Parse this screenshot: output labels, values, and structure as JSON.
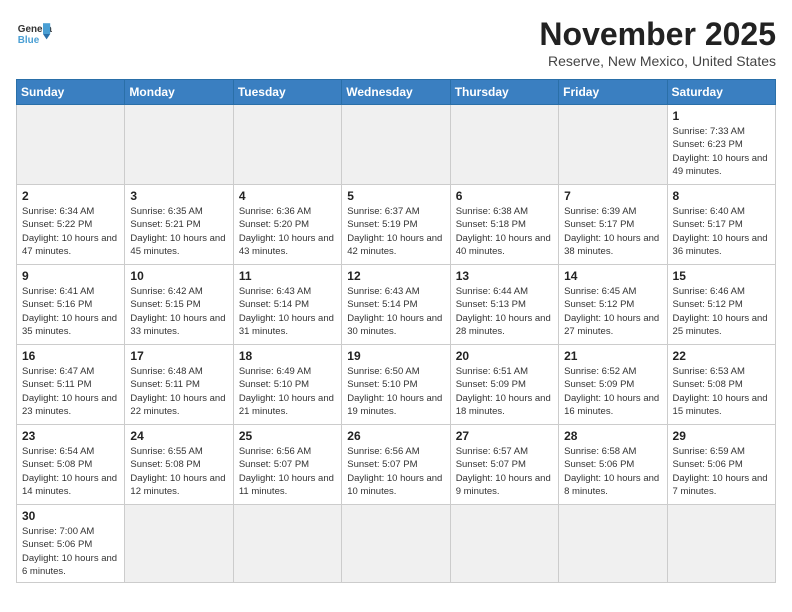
{
  "header": {
    "logo_line1": "General",
    "logo_line2": "Blue",
    "month_title": "November 2025",
    "location": "Reserve, New Mexico, United States"
  },
  "weekdays": [
    "Sunday",
    "Monday",
    "Tuesday",
    "Wednesday",
    "Thursday",
    "Friday",
    "Saturday"
  ],
  "weeks": [
    [
      {
        "day": "",
        "info": ""
      },
      {
        "day": "",
        "info": ""
      },
      {
        "day": "",
        "info": ""
      },
      {
        "day": "",
        "info": ""
      },
      {
        "day": "",
        "info": ""
      },
      {
        "day": "",
        "info": ""
      },
      {
        "day": "1",
        "info": "Sunrise: 7:33 AM\nSunset: 6:23 PM\nDaylight: 10 hours\nand 49 minutes."
      }
    ],
    [
      {
        "day": "2",
        "info": "Sunrise: 6:34 AM\nSunset: 5:22 PM\nDaylight: 10 hours\nand 47 minutes."
      },
      {
        "day": "3",
        "info": "Sunrise: 6:35 AM\nSunset: 5:21 PM\nDaylight: 10 hours\nand 45 minutes."
      },
      {
        "day": "4",
        "info": "Sunrise: 6:36 AM\nSunset: 5:20 PM\nDaylight: 10 hours\nand 43 minutes."
      },
      {
        "day": "5",
        "info": "Sunrise: 6:37 AM\nSunset: 5:19 PM\nDaylight: 10 hours\nand 42 minutes."
      },
      {
        "day": "6",
        "info": "Sunrise: 6:38 AM\nSunset: 5:18 PM\nDaylight: 10 hours\nand 40 minutes."
      },
      {
        "day": "7",
        "info": "Sunrise: 6:39 AM\nSunset: 5:17 PM\nDaylight: 10 hours\nand 38 minutes."
      },
      {
        "day": "8",
        "info": "Sunrise: 6:40 AM\nSunset: 5:17 PM\nDaylight: 10 hours\nand 36 minutes."
      }
    ],
    [
      {
        "day": "9",
        "info": "Sunrise: 6:41 AM\nSunset: 5:16 PM\nDaylight: 10 hours\nand 35 minutes."
      },
      {
        "day": "10",
        "info": "Sunrise: 6:42 AM\nSunset: 5:15 PM\nDaylight: 10 hours\nand 33 minutes."
      },
      {
        "day": "11",
        "info": "Sunrise: 6:43 AM\nSunset: 5:14 PM\nDaylight: 10 hours\nand 31 minutes."
      },
      {
        "day": "12",
        "info": "Sunrise: 6:43 AM\nSunset: 5:14 PM\nDaylight: 10 hours\nand 30 minutes."
      },
      {
        "day": "13",
        "info": "Sunrise: 6:44 AM\nSunset: 5:13 PM\nDaylight: 10 hours\nand 28 minutes."
      },
      {
        "day": "14",
        "info": "Sunrise: 6:45 AM\nSunset: 5:12 PM\nDaylight: 10 hours\nand 27 minutes."
      },
      {
        "day": "15",
        "info": "Sunrise: 6:46 AM\nSunset: 5:12 PM\nDaylight: 10 hours\nand 25 minutes."
      }
    ],
    [
      {
        "day": "16",
        "info": "Sunrise: 6:47 AM\nSunset: 5:11 PM\nDaylight: 10 hours\nand 23 minutes."
      },
      {
        "day": "17",
        "info": "Sunrise: 6:48 AM\nSunset: 5:11 PM\nDaylight: 10 hours\nand 22 minutes."
      },
      {
        "day": "18",
        "info": "Sunrise: 6:49 AM\nSunset: 5:10 PM\nDaylight: 10 hours\nand 21 minutes."
      },
      {
        "day": "19",
        "info": "Sunrise: 6:50 AM\nSunset: 5:10 PM\nDaylight: 10 hours\nand 19 minutes."
      },
      {
        "day": "20",
        "info": "Sunrise: 6:51 AM\nSunset: 5:09 PM\nDaylight: 10 hours\nand 18 minutes."
      },
      {
        "day": "21",
        "info": "Sunrise: 6:52 AM\nSunset: 5:09 PM\nDaylight: 10 hours\nand 16 minutes."
      },
      {
        "day": "22",
        "info": "Sunrise: 6:53 AM\nSunset: 5:08 PM\nDaylight: 10 hours\nand 15 minutes."
      }
    ],
    [
      {
        "day": "23",
        "info": "Sunrise: 6:54 AM\nSunset: 5:08 PM\nDaylight: 10 hours\nand 14 minutes."
      },
      {
        "day": "24",
        "info": "Sunrise: 6:55 AM\nSunset: 5:08 PM\nDaylight: 10 hours\nand 12 minutes."
      },
      {
        "day": "25",
        "info": "Sunrise: 6:56 AM\nSunset: 5:07 PM\nDaylight: 10 hours\nand 11 minutes."
      },
      {
        "day": "26",
        "info": "Sunrise: 6:56 AM\nSunset: 5:07 PM\nDaylight: 10 hours\nand 10 minutes."
      },
      {
        "day": "27",
        "info": "Sunrise: 6:57 AM\nSunset: 5:07 PM\nDaylight: 10 hours\nand 9 minutes."
      },
      {
        "day": "28",
        "info": "Sunrise: 6:58 AM\nSunset: 5:06 PM\nDaylight: 10 hours\nand 8 minutes."
      },
      {
        "day": "29",
        "info": "Sunrise: 6:59 AM\nSunset: 5:06 PM\nDaylight: 10 hours\nand 7 minutes."
      }
    ],
    [
      {
        "day": "30",
        "info": "Sunrise: 7:00 AM\nSunset: 5:06 PM\nDaylight: 10 hours\nand 6 minutes."
      },
      {
        "day": "",
        "info": ""
      },
      {
        "day": "",
        "info": ""
      },
      {
        "day": "",
        "info": ""
      },
      {
        "day": "",
        "info": ""
      },
      {
        "day": "",
        "info": ""
      },
      {
        "day": "",
        "info": ""
      }
    ]
  ]
}
